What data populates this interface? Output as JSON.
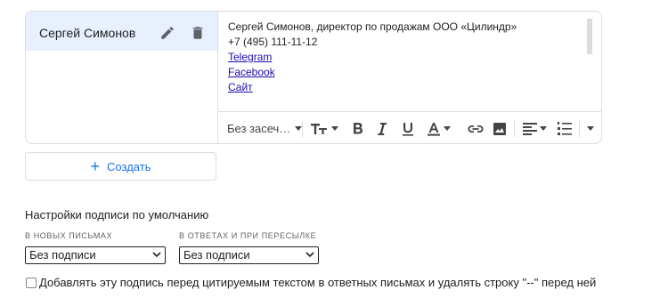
{
  "signatures": [
    {
      "name": "Сергей Симонов",
      "content": {
        "line1": "Сергей Симонов, директор по продажам ООО «Цилиндр»",
        "line2": "+7 (495) 111-11-12",
        "links": [
          "Telegram",
          "Facebook",
          "Сайт"
        ]
      }
    }
  ],
  "toolbar": {
    "font_label": "Без засеч…"
  },
  "create_button": {
    "label": "Создать"
  },
  "defaults": {
    "title": "Настройки подписи по умолчанию",
    "new_messages": {
      "label": "В НОВЫХ ПИСЬМАХ",
      "selected": "Без подписи"
    },
    "replies": {
      "label": "В ОТВЕТАХ И ПРИ ПЕРЕСЫЛКЕ",
      "selected": "Без подписи"
    },
    "insert_before_quote": {
      "label": "Добавлять эту подпись перед цитируемым текстом в ответных письмах и удалять строку \"--\" перед ней",
      "checked": false
    }
  },
  "colors": {
    "selected_bg": "#e8f0fe",
    "accent": "#1a73e8",
    "link": "#1a0dab",
    "border": "#dadce0"
  }
}
